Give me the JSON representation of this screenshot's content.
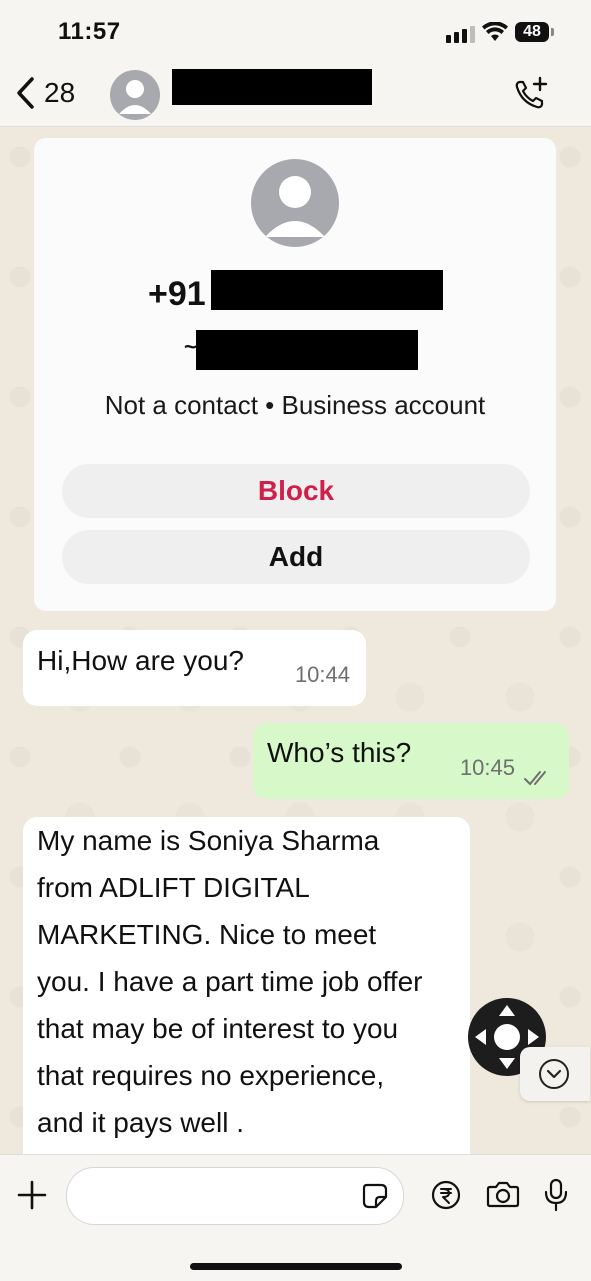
{
  "status_bar": {
    "time": "11:57",
    "battery": "48"
  },
  "header": {
    "back_count": "28"
  },
  "contact_card": {
    "phone_prefix": "+91",
    "name_prefix": "~",
    "meta": "Not a contact • Business account",
    "block_label": "Block",
    "add_label": "Add"
  },
  "messages": [
    {
      "direction": "incoming",
      "text": "Hi,How are you?",
      "time": "10:44"
    },
    {
      "direction": "outgoing",
      "text": "Who’s this?",
      "time": "10:45",
      "status": "read"
    },
    {
      "direction": "incoming",
      "lines": [
        "My name is Soniya Sharma",
        "from ADLIFT DIGITAL",
        "MARKETING. Nice to meet",
        "you. I have a part time job offer",
        "that may be of interest to you",
        "that requires no experience,",
        "and it pays well ."
      ]
    }
  ],
  "input": {
    "placeholder": ""
  },
  "colors": {
    "block": "#d01f4a",
    "outgoing_bubble": "#d7f9c9",
    "read_ticks": "#6f6f6f"
  }
}
